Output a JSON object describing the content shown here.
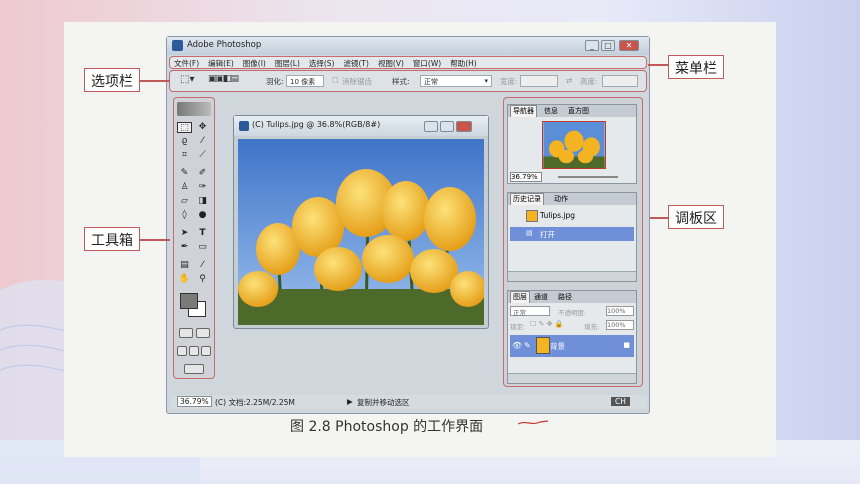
{
  "window": {
    "title": "Adobe Photoshop",
    "min": "_",
    "max": "□",
    "close": "✕"
  },
  "menubar": {
    "items": [
      "文件(F)",
      "编辑(E)",
      "图像(I)",
      "图层(L)",
      "选择(S)",
      "滤镜(T)",
      "视图(V)",
      "窗口(W)",
      "帮助(H)"
    ]
  },
  "options": {
    "feather_label": "羽化:",
    "feather_value": "10 像素",
    "antialias": "消除锯齿",
    "style_label": "样式:",
    "style_value": "正常",
    "width_label": "宽度:",
    "height_label": "高度:"
  },
  "document": {
    "title": "(C) Tulips.jpg @ 36.8%(RGB/8#)"
  },
  "palettes": {
    "navigator_tabs": [
      "导航器",
      "信息",
      "直方图"
    ],
    "zoom": "36.79%",
    "history_tabs": [
      "历史记录",
      "动作"
    ],
    "history_items": [
      "Tulips.jpg",
      "打开"
    ],
    "layers_tabs": [
      "图层",
      "通道",
      "路径"
    ],
    "blend_mode": "正常",
    "opacity_label": "不透明度:",
    "opacity_value": "100%",
    "lock_label": "锁定:",
    "fill_label": "填充:",
    "fill_value": "100%",
    "layer_name": "背景"
  },
  "status": {
    "zoom": "36.79%",
    "doc_info": "(C) 文档:2.25M/2.25M",
    "hint": "复制并移动选区",
    "corner": "CH"
  },
  "annotations": {
    "options_bar": "选项栏",
    "menu_bar": "菜单栏",
    "toolbox": "工具箱",
    "palettes": "调板区"
  },
  "caption": "图 2.8  Photoshop 的工作界面",
  "colors": {
    "annotation_border": "#c05a5a",
    "layer_selected": "#6f8fd8",
    "tulip": "#f4b422",
    "sky": "#5a8fd8"
  }
}
